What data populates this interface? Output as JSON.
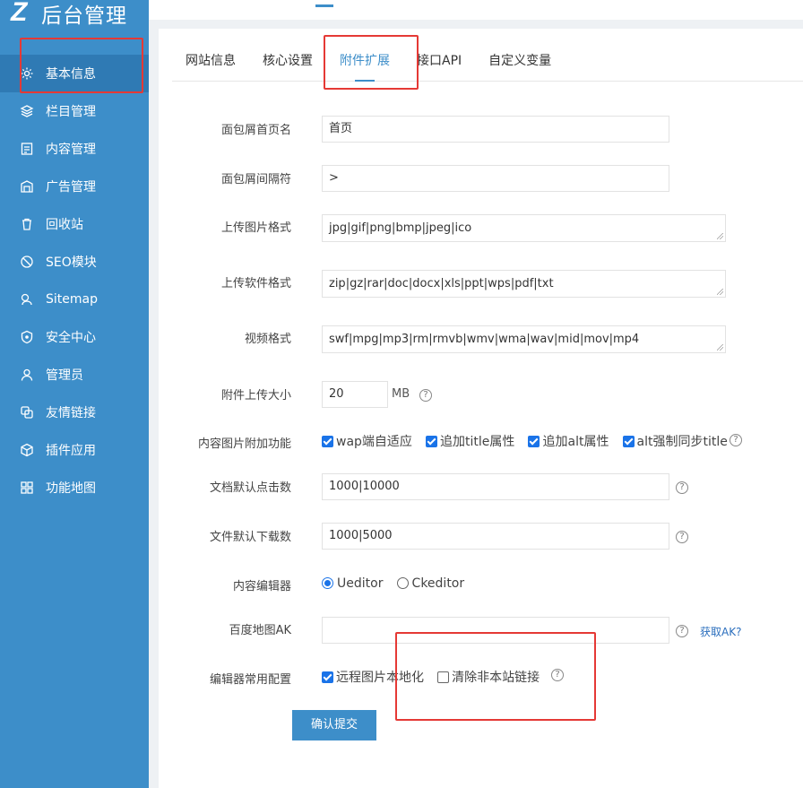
{
  "app": {
    "logo_mark": "Z",
    "title": "后台管理"
  },
  "sidebar": {
    "items": [
      {
        "label": "基本信息",
        "icon": "gear-icon",
        "active": true
      },
      {
        "label": "栏目管理",
        "icon": "layers-icon"
      },
      {
        "label": "内容管理",
        "icon": "document-icon"
      },
      {
        "label": "广告管理",
        "icon": "ad-icon"
      },
      {
        "label": "回收站",
        "icon": "trash-icon"
      },
      {
        "label": "SEO模块",
        "icon": "seo-icon"
      },
      {
        "label": "Sitemap",
        "icon": "sitemap-icon"
      },
      {
        "label": "安全中心",
        "icon": "shield-icon"
      },
      {
        "label": "管理员",
        "icon": "user-icon"
      },
      {
        "label": "友情链接",
        "icon": "link-icon"
      },
      {
        "label": "插件应用",
        "icon": "cube-icon"
      },
      {
        "label": "功能地图",
        "icon": "grid-icon"
      }
    ]
  },
  "tabs": [
    {
      "label": "网站信息"
    },
    {
      "label": "核心设置"
    },
    {
      "label": "附件扩展",
      "active": true
    },
    {
      "label": "接口API"
    },
    {
      "label": "自定义变量"
    }
  ],
  "form": {
    "breadcrumb_home": {
      "label": "面包屑首页名",
      "value": "首页"
    },
    "breadcrumb_sep": {
      "label": "面包屑间隔符",
      "value": ">"
    },
    "img_formats": {
      "label": "上传图片格式",
      "value": "jpg|gif|png|bmp|jpeg|ico"
    },
    "soft_formats": {
      "label": "上传软件格式",
      "value": "zip|gz|rar|doc|docx|xls|ppt|wps|pdf|txt"
    },
    "video_formats": {
      "label": "视频格式",
      "value": "swf|mpg|mp3|rm|rmvb|wmv|wma|wav|mid|mov|mp4"
    },
    "upload_size": {
      "label": "附件上传大小",
      "value": "20",
      "unit": "MB"
    },
    "img_features": {
      "label": "内容图片附加功能",
      "options": [
        {
          "label": "wap端自适应",
          "checked": true
        },
        {
          "label": "追加title属性",
          "checked": true
        },
        {
          "label": "追加alt属性",
          "checked": true
        },
        {
          "label": "alt强制同步title",
          "checked": true
        }
      ]
    },
    "default_clicks": {
      "label": "文档默认点击数",
      "value": "1000|10000"
    },
    "default_downloads": {
      "label": "文件默认下载数",
      "value": "1000|5000"
    },
    "editor": {
      "label": "内容编辑器",
      "options": [
        {
          "label": "Ueditor",
          "selected": true
        },
        {
          "label": "Ckeditor",
          "selected": false
        }
      ]
    },
    "baidu_ak": {
      "label": "百度地图AK",
      "value": "",
      "link": "获取AK?"
    },
    "editor_config": {
      "label": "编辑器常用配置",
      "options": [
        {
          "label": "远程图片本地化",
          "checked": true
        },
        {
          "label": "清除非本站链接",
          "checked": false
        }
      ]
    },
    "submit_label": "确认提交",
    "help_glyph": "?"
  },
  "colors": {
    "sidebar": "#3d8ec9",
    "accent": "#3d8ec9",
    "highlight": "#e53935"
  }
}
